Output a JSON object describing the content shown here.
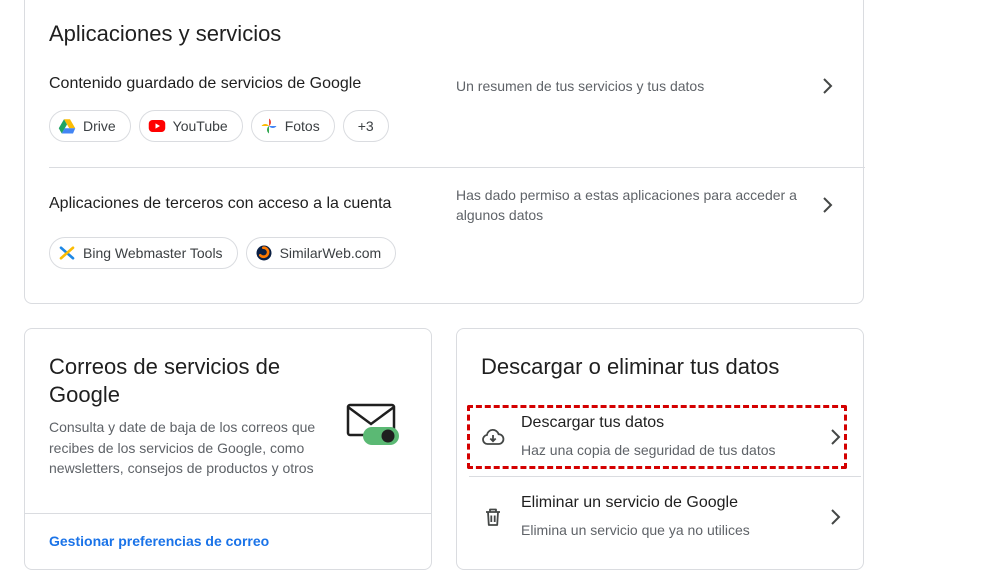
{
  "apps_section": {
    "title": "Aplicaciones y servicios",
    "google_content": {
      "label": "Contenido guardado de servicios de Google",
      "description": "Un resumen de tus servicios y tus datos",
      "chips": [
        "Drive",
        "YouTube",
        "Fotos",
        "+3"
      ]
    },
    "third_party": {
      "label": "Aplicaciones de terceros con acceso a la cuenta",
      "description": "Has dado permiso a estas aplicaciones para acceder a algunos datos",
      "chips": [
        "Bing Webmaster Tools",
        "SimilarWeb.com"
      ]
    }
  },
  "email_section": {
    "title": "Correos de servicios de Google",
    "description": "Consulta y date de baja de los correos que recibes de los servicios de Google, como newsletters, consejos de productos y otros",
    "link": "Gestionar preferencias de correo"
  },
  "download_section": {
    "title": "Descargar o eliminar tus datos",
    "items": [
      {
        "title": "Descargar tus datos",
        "subtitle": "Haz una copia de seguridad de tus datos",
        "icon": "cloud-download-icon"
      },
      {
        "title": "Eliminar un servicio de Google",
        "subtitle": "Elimina un servicio que ya no utilices",
        "icon": "trash-icon"
      }
    ]
  },
  "colors": {
    "link": "#1a73e8",
    "highlight": "#d40000",
    "toggle": "#5bb974"
  }
}
